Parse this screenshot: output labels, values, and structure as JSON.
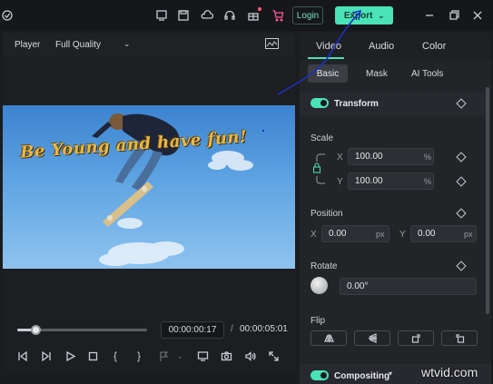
{
  "titlebar": {
    "login_label": "Login",
    "export_label": "Export",
    "icons": [
      "settings-icon",
      "monitor-icon",
      "save-icon",
      "cloud-icon",
      "headset-icon",
      "gift-icon",
      "cart-icon",
      "minimize-icon",
      "restore-icon",
      "close-icon"
    ]
  },
  "player": {
    "label": "Player",
    "quality": "Full Quality",
    "video_text": "Be Young and have fun!",
    "current_time": "00:00:00:17",
    "separator": "/",
    "total_time": "00:00:05:01",
    "progress": 0.14
  },
  "panel": {
    "tabs": [
      "Video",
      "Audio",
      "Color"
    ],
    "subtabs": [
      "Basic",
      "Mask",
      "AI Tools"
    ],
    "transform": {
      "title": "Transform",
      "scale_label": "Scale",
      "scale_x_axis": "X",
      "scale_x": "100.00",
      "scale_y_axis": "Y",
      "scale_y": "100.00",
      "percent": "%",
      "position_label": "Position",
      "pos_x_axis": "X",
      "pos_x": "0.00",
      "pos_y_axis": "Y",
      "pos_y": "0.00",
      "px": "px",
      "rotate_label": "Rotate",
      "rotate_value": "0.00°",
      "flip_label": "Flip"
    },
    "compositing": {
      "title": "Compositing"
    }
  },
  "watermark": "wtvid.com",
  "colors": {
    "accent": "#4ae3b5",
    "annotation": "#1e2fbf"
  }
}
